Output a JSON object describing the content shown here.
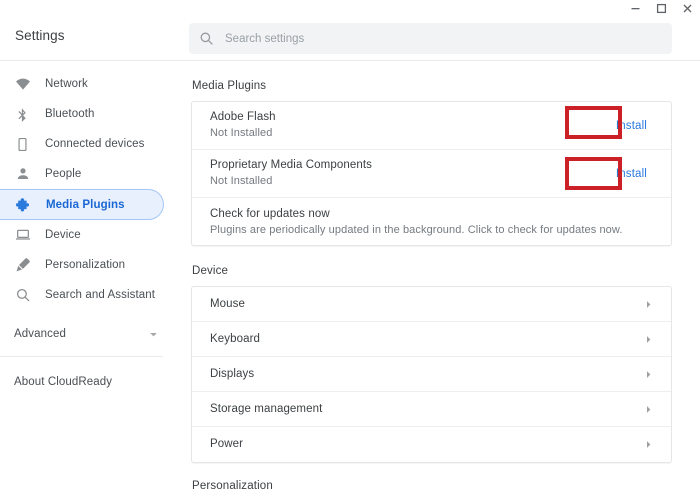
{
  "window": {
    "controls": [
      {
        "name": "minimize",
        "glyph": "minimize-icon"
      },
      {
        "name": "maximize",
        "glyph": "maximize-icon"
      },
      {
        "name": "close",
        "glyph": "close-icon"
      }
    ]
  },
  "header": {
    "app_title": "Settings",
    "search": {
      "placeholder": "Search settings",
      "value": "",
      "icon": "search-icon"
    }
  },
  "sidebar": {
    "items": [
      {
        "label": "Network",
        "icon": "wifi-icon",
        "selected": false
      },
      {
        "label": "Bluetooth",
        "icon": "bluetooth-icon",
        "selected": false
      },
      {
        "label": "Connected devices",
        "icon": "smartphone-icon",
        "selected": false
      },
      {
        "label": "People",
        "icon": "person-icon",
        "selected": false
      },
      {
        "label": "Media Plugins",
        "icon": "puzzle-piece-icon",
        "selected": true
      },
      {
        "label": "Device",
        "icon": "laptop-icon",
        "selected": false
      },
      {
        "label": "Personalization",
        "icon": "paintbrush-icon",
        "selected": false
      },
      {
        "label": "Search and Assistant",
        "icon": "magnifier-icon",
        "selected": false
      }
    ],
    "advanced": {
      "label": "Advanced",
      "icon": "chevron-down-icon"
    },
    "about": {
      "label": "About CloudReady"
    }
  },
  "main": {
    "media_plugins": {
      "section_title": "Media Plugins",
      "rows": [
        {
          "title": "Adobe Flash",
          "status": "Not Installed",
          "action_label": "Install",
          "highlighted": true
        },
        {
          "title": "Proprietary Media Components",
          "status": "Not Installed",
          "action_label": "Install",
          "highlighted": true
        }
      ],
      "updates": {
        "title": "Check for updates now",
        "description": "Plugins are periodically updated in the background. Click to check for updates now."
      }
    },
    "device": {
      "section_title": "Device",
      "rows": [
        {
          "label": "Mouse",
          "chevron": "chevron-right-icon"
        },
        {
          "label": "Keyboard",
          "chevron": "chevron-right-icon"
        },
        {
          "label": "Displays",
          "chevron": "chevron-right-icon"
        },
        {
          "label": "Storage management",
          "chevron": "chevron-right-icon"
        },
        {
          "label": "Power",
          "chevron": "chevron-right-icon"
        }
      ]
    },
    "next_section_partial": {
      "section_title": "Personalization"
    }
  },
  "colors": {
    "accent_blue": "#2a7ade",
    "selected_nav_bg": "#e8f0fe",
    "selected_nav_text": "#1967d2",
    "highlight_red": "#cb2026",
    "text_primary": "#3c4043",
    "text_secondary": "#747a80",
    "card_border": "#e4e6e8",
    "search_bg": "#f1f3f4"
  }
}
